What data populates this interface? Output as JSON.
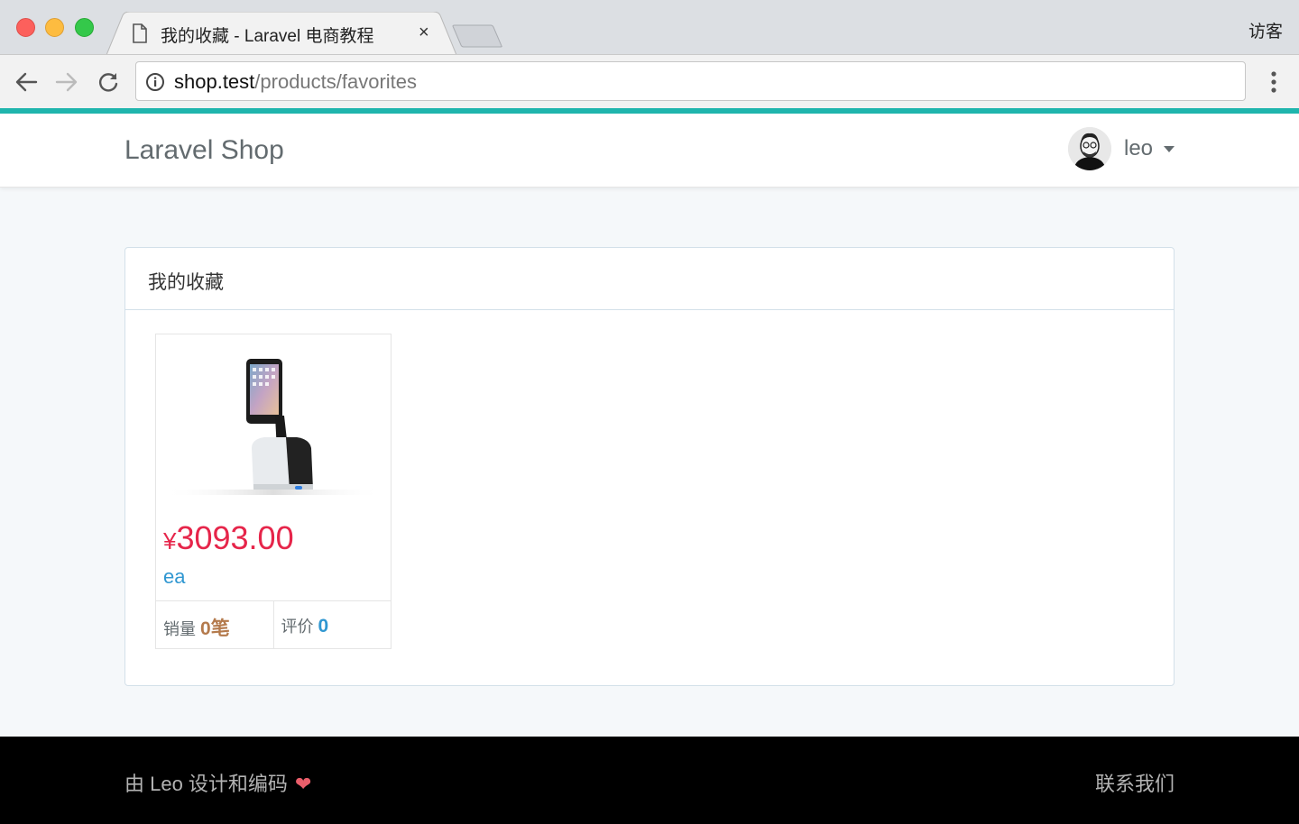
{
  "browser": {
    "tab_title": "我的收藏 - Laravel 电商教程",
    "tab_close": "×",
    "profile_label": "访客",
    "url_host": "shop.test",
    "url_path": "/products/favorites"
  },
  "navbar": {
    "brand": "Laravel Shop",
    "username": "leo"
  },
  "panel": {
    "heading": "我的收藏",
    "products": [
      {
        "currency": "¥",
        "price": "3093.00",
        "title": "ea",
        "sold_label": "销量",
        "sold_value": "0笔",
        "review_label": "评价",
        "review_value": "0"
      }
    ]
  },
  "footer": {
    "credit": "由 Leo 设计和编码",
    "heart": "❤",
    "contact": "联系我们"
  },
  "colors": {
    "accent_strip": "#1fb5ad",
    "price": "#e6254a",
    "link": "#3097d1",
    "sold": "#b47a4c",
    "footer_bg": "#000000"
  },
  "icons": [
    "document-icon",
    "back-arrow-icon",
    "forward-arrow-icon",
    "reload-icon",
    "info-icon",
    "menu-dots-icon",
    "avatar",
    "caret-down-icon",
    "heart-icon"
  ]
}
